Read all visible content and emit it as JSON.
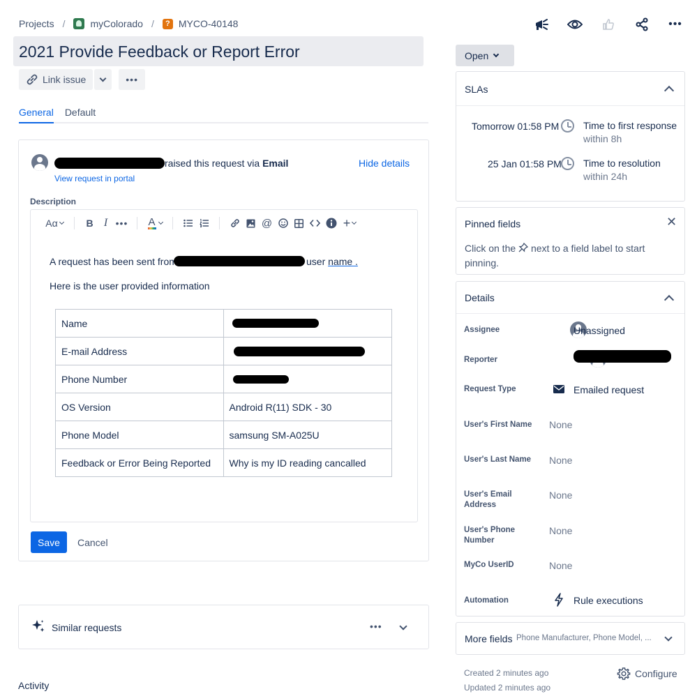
{
  "breadcrumb": {
    "projects": "Projects",
    "sep": "/",
    "project": "myColorado",
    "issue_key": "MYCO-40148",
    "issue_icon": "?"
  },
  "header": {
    "title": "2021 Provide Feedback or Report Error",
    "link_issue": "Link issue",
    "more": "•••"
  },
  "tabs": [
    "General",
    "Default"
  ],
  "request": {
    "raised_text": "raised this request via",
    "channel": "Email",
    "hide_details": "Hide details",
    "view_portal": "View request in portal",
    "description_label": "Description"
  },
  "editor": {
    "text_style": "Aα",
    "line1_prefix": "A request has been sent from",
    "line1_suffix": "user",
    "line1_link": "name .",
    "line2": "Here is the user provided information",
    "table": [
      {
        "label": "Name",
        "value": ""
      },
      {
        "label": "E-mail Address",
        "value": ""
      },
      {
        "label": "Phone Number",
        "value": ""
      },
      {
        "label": "OS Version",
        "value": "Android R(11) SDK - 30"
      },
      {
        "label": "Phone Model",
        "value": "samsung SM-A025U"
      },
      {
        "label": "Feedback or Error Being Reported",
        "value": "Why is my ID reading cancalled"
      }
    ],
    "save": "Save",
    "cancel": "Cancel"
  },
  "similar": {
    "title": "Similar requests",
    "more": "•••"
  },
  "activity": "Activity",
  "status": "Open",
  "slas": {
    "title": "SLAs",
    "items": [
      {
        "time": "Tomorrow 01:58 PM",
        "name": "Time to first response",
        "within": "within 8h"
      },
      {
        "time": "25 Jan 01:58 PM",
        "name": "Time to resolution",
        "within": "within 24h"
      }
    ]
  },
  "pinned": {
    "title": "Pinned fields",
    "text_before": "Click on the",
    "text_after": "next to a field label to start",
    "text_line2": "pinning."
  },
  "details": {
    "title": "Details",
    "assignee_label": "Assignee",
    "assignee_value": "Unassigned",
    "reporter_label": "Reporter",
    "request_type_label": "Request Type",
    "request_type_value": "Emailed request",
    "first_name_label": "User's First Name",
    "first_name_value": "None",
    "last_name_label": "User's Last Name",
    "last_name_value": "None",
    "email_label_1": "User's Email",
    "email_label_2": "Address",
    "email_value": "None",
    "phone_label_1": "User's Phone",
    "phone_label_2": "Number",
    "phone_value": "None",
    "myco_label": "MyCo UserID",
    "myco_value": "None",
    "automation_label": "Automation",
    "automation_value": "Rule executions"
  },
  "more_fields": {
    "title": "More fields",
    "summary": "Phone Manufacturer, Phone Model, ..."
  },
  "footer": {
    "created": "Created 2 minutes ago",
    "updated": "Updated 2 minutes ago",
    "configure": "Configure"
  }
}
